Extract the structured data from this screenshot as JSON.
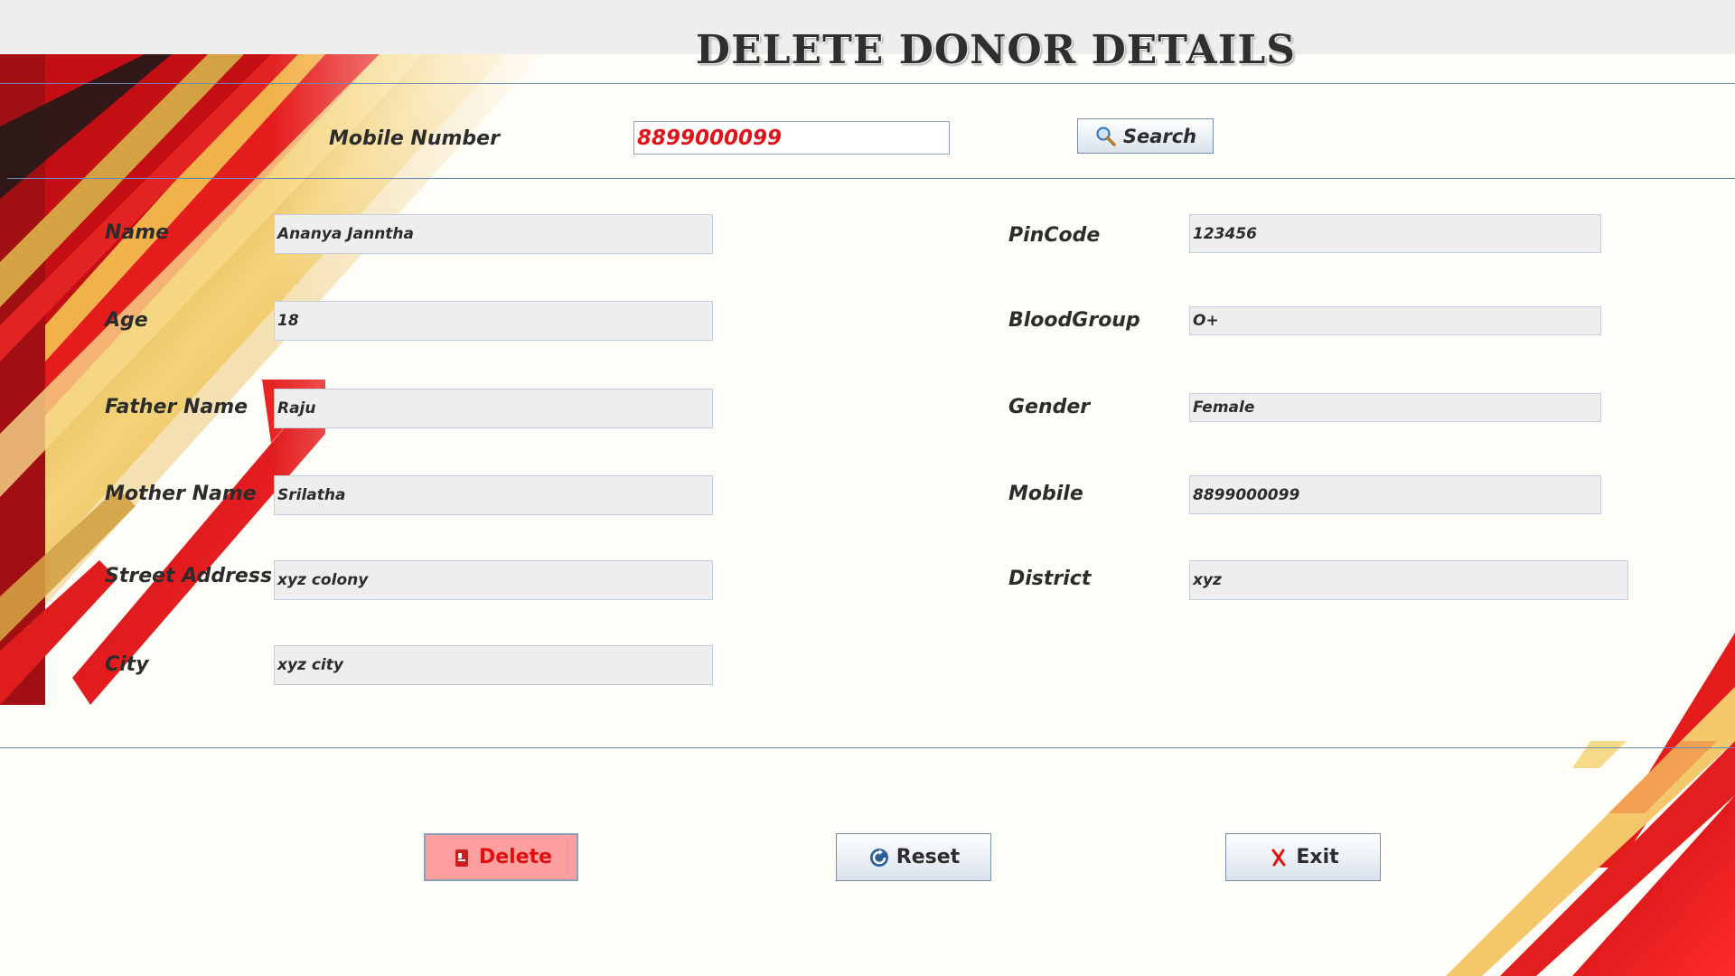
{
  "title": "DELETE DONOR DETAILS",
  "search": {
    "label": "Mobile Number",
    "value": "8899000099",
    "button_label": "Search"
  },
  "form": {
    "left": [
      {
        "label": "Name",
        "value": "Ananya Janntha"
      },
      {
        "label": "Age",
        "value": "18"
      },
      {
        "label": "Father Name",
        "value": "Raju"
      },
      {
        "label": "Mother Name",
        "value": "Srilatha"
      },
      {
        "label": "Street Address",
        "value": "xyz colony"
      },
      {
        "label": "City",
        "value": "xyz city"
      }
    ],
    "right": [
      {
        "label": "PinCode",
        "value": "123456"
      },
      {
        "label": "BloodGroup",
        "value": "O+"
      },
      {
        "label": "Gender",
        "value": "Female"
      },
      {
        "label": "Mobile",
        "value": "8899000099"
      },
      {
        "label": "District",
        "value": "xyz"
      }
    ]
  },
  "actions": {
    "delete_label": "Delete",
    "reset_label": "Reset",
    "exit_label": "Exit"
  },
  "colors": {
    "accent_red": "#e0131b",
    "delete_bg": "#ff9f9f",
    "divider": "#6b8bb5"
  },
  "icons": {
    "search": "magnifier-icon",
    "delete": "trash-icon",
    "reset": "refresh-icon",
    "exit": "close-x-icon"
  }
}
